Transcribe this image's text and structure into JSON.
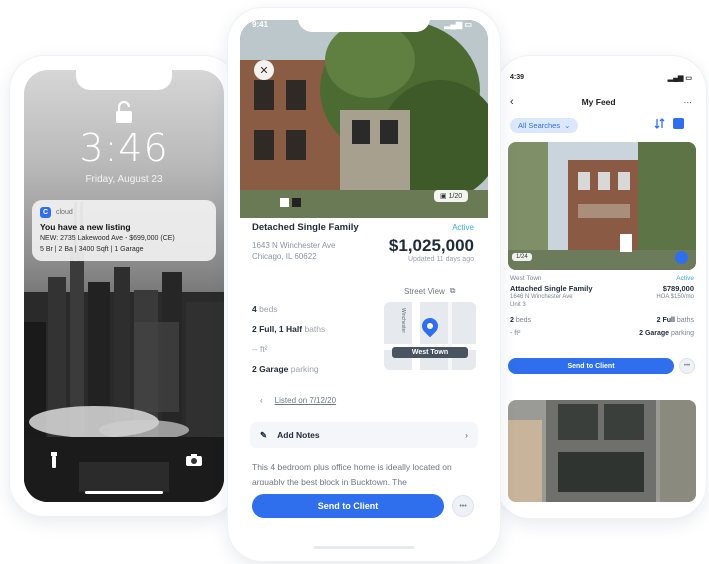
{
  "lock_screen": {
    "time": "3:46",
    "date": "Friday, August 23",
    "notification": {
      "app": "cloud",
      "title": "You have a new listing",
      "line1": "NEW: 2735 Lakewood Ave - $699,000 (CE)",
      "line2": "5 Br | 2 Ba | 3400 Sqft | 1 Garage"
    }
  },
  "detail": {
    "status_time": "9:41",
    "photo_count": "1/20",
    "property_type": "Detached Single Family",
    "status": "Active",
    "address_line1": "1643 N Winchester Ave",
    "address_line2": "Chicago, IL 60622",
    "price": "$1,025,000",
    "updated": "Updated 11 days ago",
    "street_view": "Street View",
    "facts": [
      {
        "value": "4",
        "label": "beds"
      },
      {
        "value": "2 Full, 1 Half",
        "label": "baths"
      },
      {
        "value": "-- ft²",
        "label": ""
      },
      {
        "value": "2 Garage",
        "label": "parking"
      }
    ],
    "map_label": "West Town",
    "map_street": "Winchester",
    "listed_on": "Listed on 7/12/20",
    "add_notes": "Add Notes",
    "description": "This 4 bedroom plus office home is ideally located on arguably the best block in Bucktown.  The",
    "send_label": "Send to Client",
    "more_label": "•••"
  },
  "feed": {
    "status_time": "4:39",
    "title": "My Feed",
    "filter_chip": "All Searches",
    "card": {
      "neighborhood": "West Town",
      "status": "Active",
      "type": "Attached Single Family",
      "price": "$789,000",
      "address1": "1646 N Winchester Ave",
      "address2": "Unit 3",
      "price_note": "HOA $150/mo",
      "beds": "2",
      "beds_label": "beds",
      "baths": "2 Full",
      "baths_label": "baths",
      "size": "- ft²",
      "parking": "2 Garage",
      "parking_label": "parking",
      "photo_tag": "1/24",
      "send_label": "Send to Client",
      "more_label": "•••"
    }
  },
  "colors": {
    "accent": "#2f6fed",
    "active": "#3aa9d6",
    "text": "#1f2a3a"
  }
}
